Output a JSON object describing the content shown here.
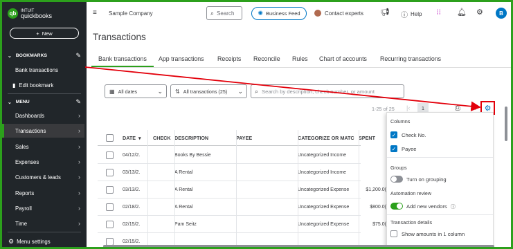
{
  "sidebar": {
    "logo_small": "INTUIT",
    "logo_big": "quickbooks",
    "new_label": "New",
    "bookmarks_label": "BOOKMARKS",
    "bookmarks": [
      "Bank transactions",
      "Edit bookmark"
    ],
    "menu_label": "MENU",
    "menu_items": [
      "Dashboards",
      "Transactions",
      "Sales",
      "Expenses",
      "Customers & leads",
      "Reports",
      "Payroll",
      "Time"
    ],
    "menu_settings": "Menu settings"
  },
  "topbar": {
    "company": "Sample Company",
    "search_label": "Search",
    "business_feed": "Business Feed",
    "contact_experts": "Contact experts",
    "help": "Help",
    "avatar_letter": "B"
  },
  "page": {
    "title": "Transactions",
    "tabs": [
      "Bank transactions",
      "App transactions",
      "Receipts",
      "Reconcile",
      "Rules",
      "Chart of accounts",
      "Recurring transactions"
    ]
  },
  "filters": {
    "dates": "All dates",
    "transactions": "All transactions (25)",
    "search_placeholder": "Search by description, check number, or amount"
  },
  "pager": {
    "range": "1-25 of 25",
    "current_page": "1"
  },
  "table": {
    "headers": {
      "date": "DATE",
      "check": "CHECK",
      "description": "DESCRIPTION",
      "payee": "PAYEE",
      "categorize": "CATEGORIZE OR MATC",
      "spent": "SPENT"
    },
    "rows": [
      {
        "date": "04/12/2.",
        "description": "Books By Bessie",
        "payee": "",
        "category": "Uncategorized Income",
        "spent": ""
      },
      {
        "date": "03/13/2.",
        "description": "A Rental",
        "payee": "",
        "category": "Uncategorized Income",
        "spent": ""
      },
      {
        "date": "03/13/2.",
        "description": "A Rental",
        "payee": "",
        "category": "Uncategorized Expense",
        "spent": "$1,200.0("
      },
      {
        "date": "02/18/2.",
        "description": "A Rental",
        "payee": "",
        "category": "Uncategorized Expense",
        "spent": "$800.0("
      },
      {
        "date": "02/15/2.",
        "description": "Pam Seitz",
        "payee": "",
        "category": "Uncategorized Expense",
        "spent": "$75.0("
      },
      {
        "date": "02/15/2.",
        "description": "",
        "payee": "",
        "category": "",
        "spent": ""
      }
    ]
  },
  "settings_panel": {
    "columns_label": "Columns",
    "check_no": "Check No.",
    "payee": "Payee",
    "groups_label": "Groups",
    "grouping_toggle": "Turn on grouping",
    "automation_label": "Automation review",
    "add_new_vendors": "Add new vendors",
    "details_label": "Transaction details",
    "show_amounts": "Show amounts in 1 column"
  },
  "colors": {
    "brand_green": "#2ca01c",
    "sidebar_bg": "#21262a",
    "accent_blue": "#0077c5",
    "annotation_red": "#e3000b"
  }
}
